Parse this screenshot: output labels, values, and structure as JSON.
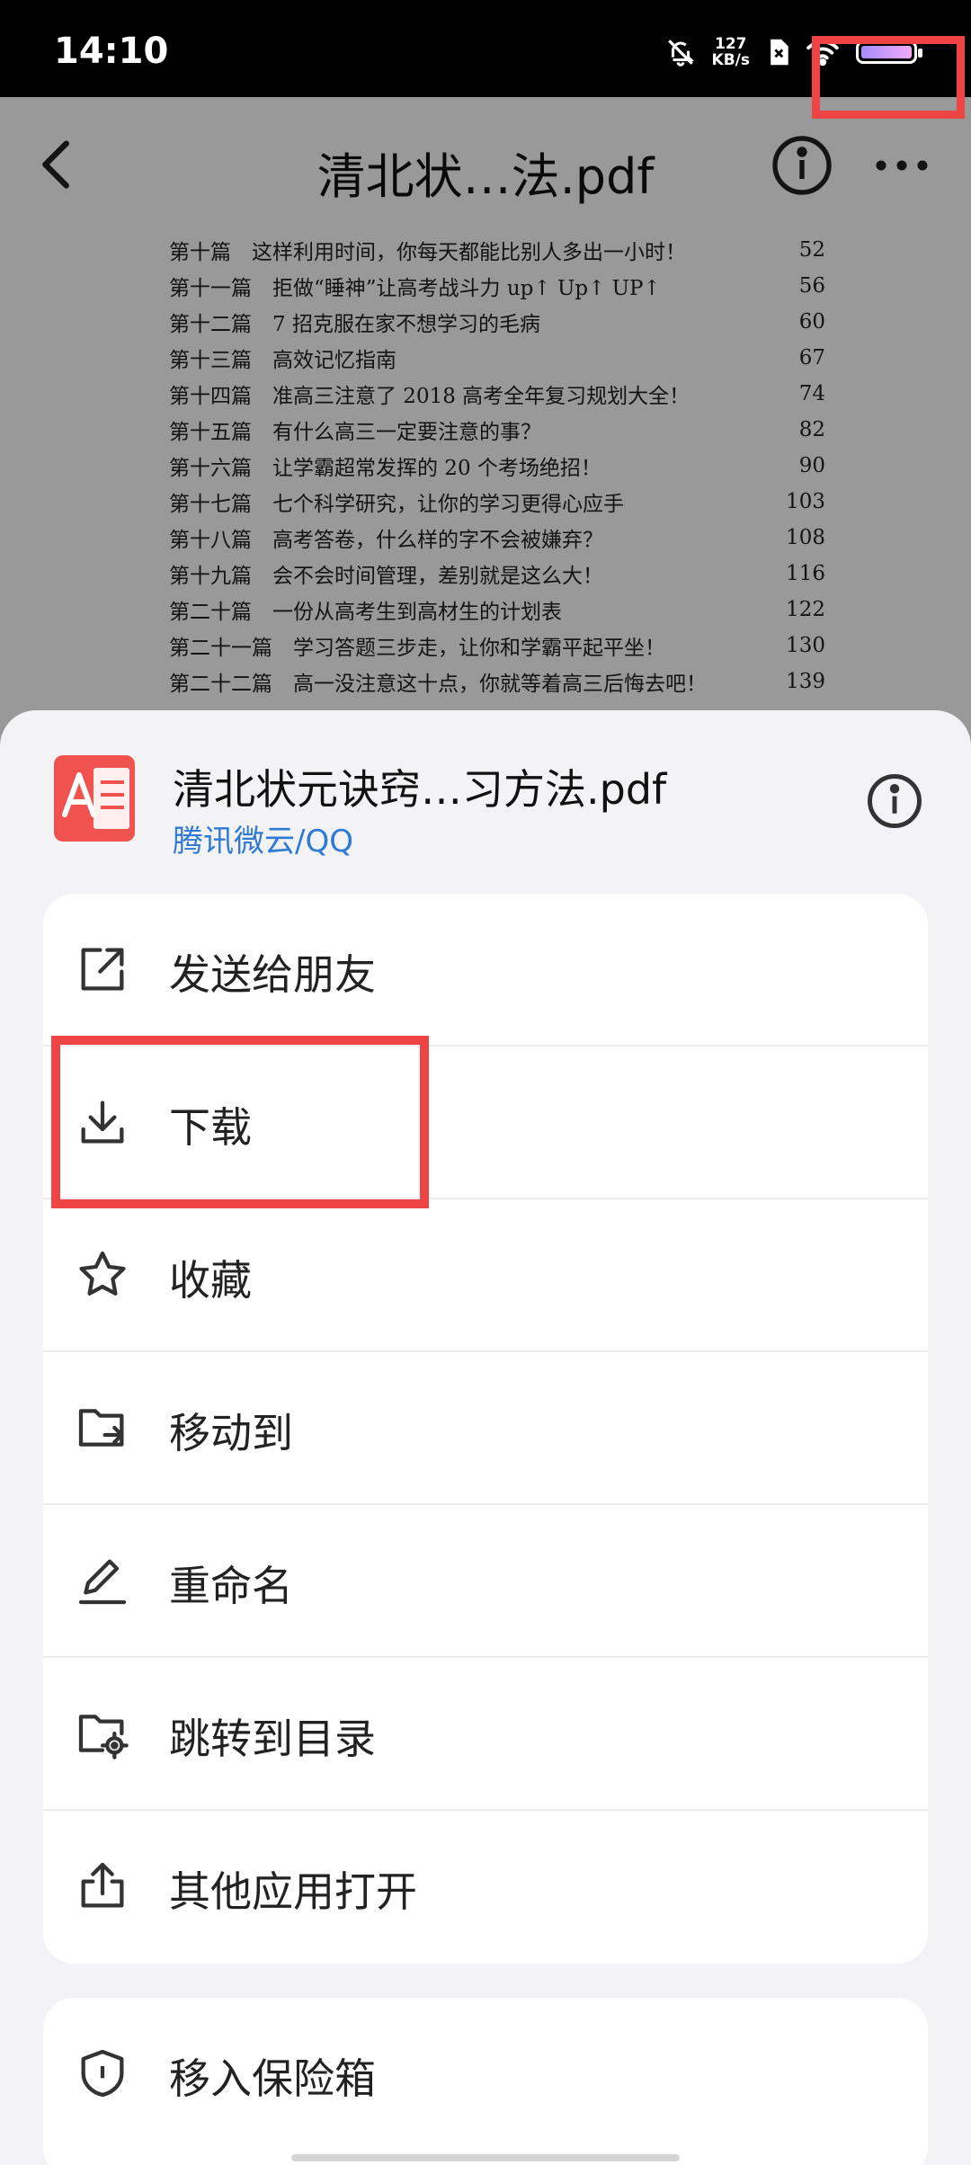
{
  "status_bar": {
    "time": "14:10",
    "speed_value": "127",
    "speed_unit": "KB/s"
  },
  "viewer": {
    "title": "清北状…法.pdf",
    "toc": [
      {
        "label": "第十篇　这样利用时间，你每天都能比别人多出一小时！",
        "page": "52"
      },
      {
        "label": "第十一篇　拒做“睡神”让高考战斗力 up↑ Up↑ UP↑",
        "page": "56"
      },
      {
        "label": "第十二篇　7 招克服在家不想学习的毛病",
        "page": "60"
      },
      {
        "label": "第十三篇　高效记忆指南",
        "page": "67"
      },
      {
        "label": "第十四篇　准高三注意了 2018 高考全年复习规划大全！",
        "page": "74"
      },
      {
        "label": "第十五篇　有什么高三一定要注意的事？",
        "page": "82"
      },
      {
        "label": "第十六篇　让学霸超常发挥的 20 个考场绝招！",
        "page": "90"
      },
      {
        "label": "第十七篇　七个科学研究，让你的学习更得心应手",
        "page": "103"
      },
      {
        "label": "第十八篇　高考答卷，什么样的字不会被嫌弃？",
        "page": "108"
      },
      {
        "label": "第十九篇　会不会时间管理，差别就是这么大！",
        "page": "116"
      },
      {
        "label": "第二十篇　一份从高考生到高材生的计划表",
        "page": "122"
      },
      {
        "label": "第二十一篇　学习答题三步走，让你和学霸平起平坐！",
        "page": "130"
      },
      {
        "label": "第二十二篇　高一没注意这十点，你就等着高三后悔去吧！",
        "page": "139"
      }
    ]
  },
  "sheet": {
    "file_name": "清北状元诀窍…习方法.pdf",
    "file_source": "腾讯微云/QQ",
    "menu": [
      {
        "label": "发送给朋友",
        "icon": "share-external-icon"
      },
      {
        "label": "下载",
        "icon": "download-icon"
      },
      {
        "label": "收藏",
        "icon": "star-icon"
      },
      {
        "label": "移动到",
        "icon": "folder-move-icon"
      },
      {
        "label": "重命名",
        "icon": "pencil-icon"
      },
      {
        "label": "跳转到目录",
        "icon": "folder-locate-icon"
      },
      {
        "label": "其他应用打开",
        "icon": "open-with-icon"
      }
    ],
    "menu2": [
      {
        "label": "移入保险箱",
        "icon": "shield-icon"
      }
    ]
  },
  "colors": {
    "highlight": "#ef4444",
    "link": "#2f7ad6",
    "pdf_red": "#f0524f"
  }
}
